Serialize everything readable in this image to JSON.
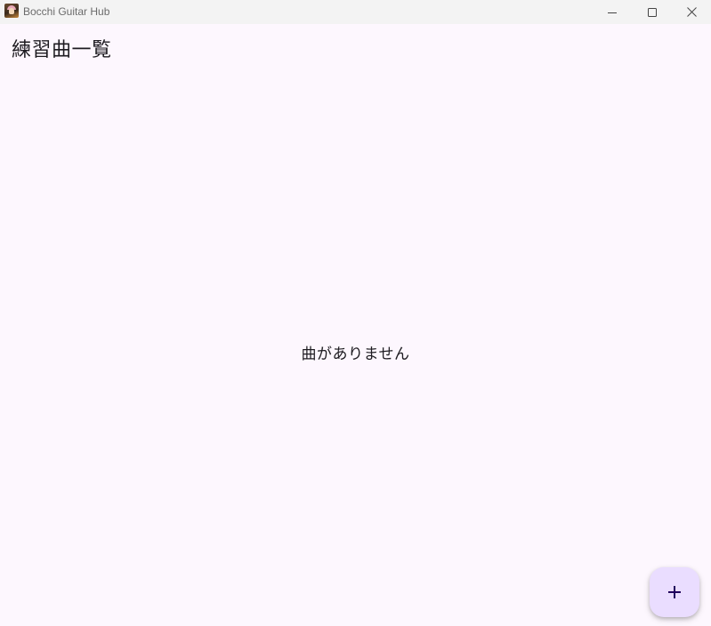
{
  "window": {
    "title": "Bocchi Guitar Hub",
    "icon": "app-icon",
    "controls": {
      "minimize": "minimize-icon",
      "maximize": "maximize-icon",
      "close": "close-icon"
    }
  },
  "page": {
    "title": "練習曲一覧",
    "empty_message": "曲がありません"
  },
  "fab": {
    "icon": "plus-icon"
  },
  "colors": {
    "background": "#fdf7fe",
    "titlebar": "#f3f3f3",
    "fab_background": "#eaddff",
    "fab_icon": "#21005d",
    "text": "#1d1b20"
  }
}
